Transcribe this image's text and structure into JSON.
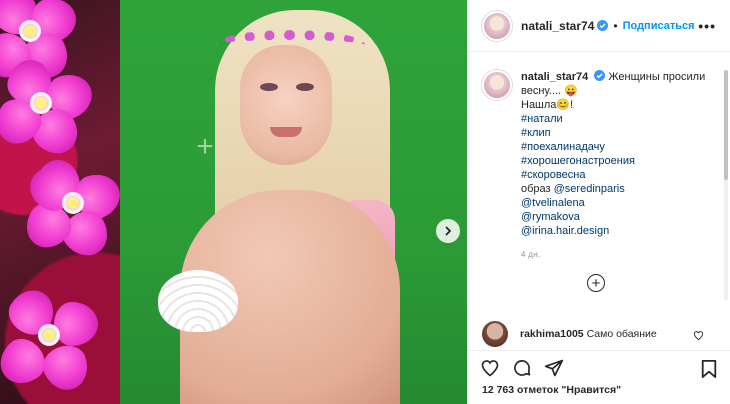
{
  "post": {
    "username": "natali_star74",
    "follow_label": "Подписаться",
    "separator": "•",
    "more_label": "•••"
  },
  "caption": {
    "username": "natali_star74",
    "line1": "Женщины просили весну.... 😛",
    "line2": "Нашла😊!",
    "hashtags": [
      "#натали",
      "#клип",
      "#поехалинадачу",
      "#хорошегонастроения",
      "#скоровесна"
    ],
    "credit_prefix": "образ ",
    "mentions": [
      "@seredinparis",
      "@tvelinalena",
      "@rymakova",
      "@irina.hair.design"
    ],
    "time": "4 дн."
  },
  "comment": {
    "username": "rakhima1005",
    "text": "Само обаяние"
  },
  "likes": {
    "text": "12 763 отметок \"Нравится\""
  },
  "icons": {
    "verified": "verified-badge-icon",
    "heart": "heart-icon",
    "comment": "comment-icon",
    "share": "share-icon",
    "bookmark": "bookmark-icon",
    "next": "chevron-right-icon",
    "add": "add-circle-icon"
  },
  "colors": {
    "accent": "#0095f6",
    "hashtag": "#00376b",
    "muted": "#8e8e8e"
  }
}
